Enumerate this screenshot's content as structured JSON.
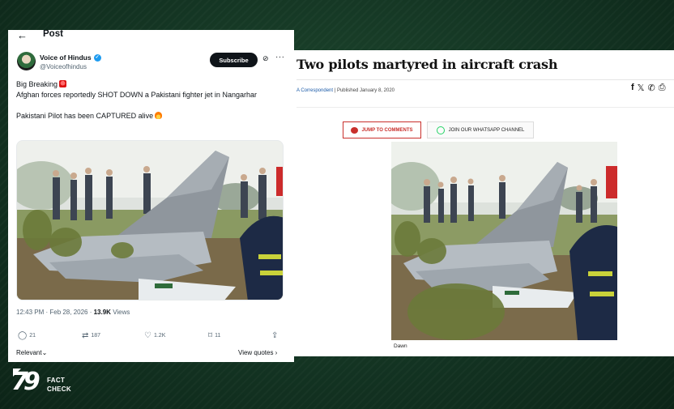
{
  "tweet": {
    "back_icon": "arrow-left-icon",
    "header_title": "Post",
    "author_name": "Voice of Hindus",
    "author_handle": "@Voiceofhindus",
    "subscribe_label": "Subscribe",
    "text_line1": "Big Breaking",
    "text_line2": "Afghan forces reportedly SHOT DOWN a Pakistani fighter jet in Nangarhar",
    "text_line3": "Pakistani Pilot has been CAPTURED alive",
    "time": "12:43 PM · Feb 28, 2026 · ",
    "views_count": "13.9K",
    "views_label": " Views",
    "replies": "21",
    "reposts": "187",
    "likes": "1.2K",
    "bookmarks": "11",
    "relevant_label": "Relevant",
    "view_quotes_label": "View quotes"
  },
  "article": {
    "title": "Two pilots martyred in aircraft crash",
    "byline_author": "A Correspondent",
    "byline_published": "Published January 8, 2020",
    "jump_to_comments": "JUMP TO COMMENTS",
    "whatsapp_channel": "JOIN OUR WHATSAPP CHANNEL",
    "photo_caption": "Dawn",
    "share_icons": [
      "facebook-icon",
      "x-icon",
      "whatsapp-icon",
      "print-icon"
    ]
  },
  "logo": {
    "number": "79",
    "line1": "FACT",
    "line2": "CHECK"
  },
  "colors": {
    "background": "#133322",
    "verified": "#1d9bf0",
    "comments_red": "#c9302c",
    "whatsapp_green": "#25d366"
  }
}
